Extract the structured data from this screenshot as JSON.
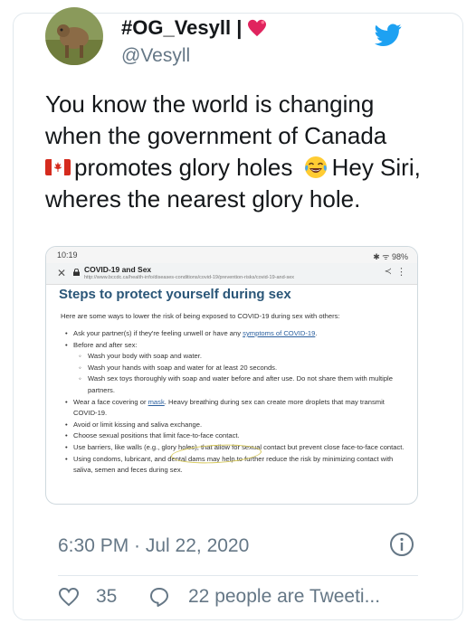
{
  "user": {
    "display_name": "#OG_Vesyll |",
    "handle": "@Vesyll"
  },
  "tweet": {
    "text_part1": "You know the world is changing when the government of Canada",
    "text_part2": "promotes glory holes",
    "text_part3": "Hey Siri, wheres the nearest glory hole."
  },
  "embedded_screenshot": {
    "status_time": "10:19",
    "status_right": "✱ ᯤ 98%",
    "site_title": "COVID-19 and Sex",
    "site_url": "http://www.bccdc.ca/health-info/diseases-conditions/covid-19/prevention-risks/covid-19-and-sex",
    "heading": "Steps to protect yourself during sex",
    "intro": "Here are some ways to lower the risk of being exposed to COVID-19 during sex with others:",
    "b1_pre": "Ask your partner(s) if they're feeling unwell or have any ",
    "b1_link": "symptoms of COVID-19",
    "b1_post": ".",
    "b2": "Before and after sex:",
    "s1": "Wash your body with soap and water.",
    "s2": "Wash your hands with soap and water for at least 20 seconds.",
    "s3": "Wash sex toys thoroughly with soap and water before and after use. Do not share them with multiple partners.",
    "b3_pre": "Wear a face covering or ",
    "b3_link": "mask",
    "b3_post": ". Heavy breathing during sex can create more droplets that may transmit COVID-19.",
    "b4": "Avoid or limit kissing and saliva exchange.",
    "b5": "Choose sexual positions that limit face-to-face contact.",
    "b6": "Use barriers, like walls (e.g., glory holes), that allow for sexual contact but prevent close face-to-face contact.",
    "b7": "Using condoms, lubricant, and dental dams may help to further reduce the risk by minimizing contact with saliva, semen and feces during sex."
  },
  "timestamp": "6:30 PM · Jul 22, 2020",
  "actions": {
    "like_count": "35",
    "people_text": "22 people are Tweeti..."
  },
  "colors": {
    "twitter_blue": "#1da1f2",
    "heart_emoji": "#e0245e",
    "heading_blue": "#2a5678"
  },
  "icons": [
    "twitter-bird-icon",
    "heart-emoji-icon",
    "canada-flag-icon",
    "tears-of-joy-emoji-icon",
    "info-icon",
    "like-heart-icon",
    "reply-bubble-icon"
  ]
}
